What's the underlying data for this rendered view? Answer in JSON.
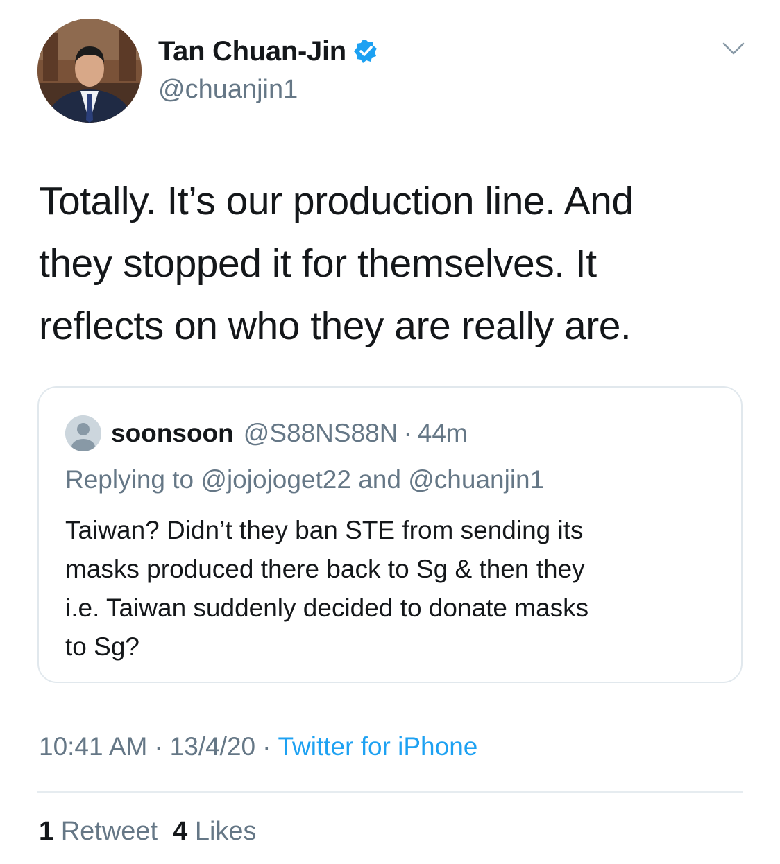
{
  "author": {
    "display_name": "Tan Chuan-Jin",
    "handle": "@chuanjin1",
    "verified": true
  },
  "icons": {
    "verified": "verified-badge-icon",
    "menu": "chevron-down-icon",
    "quoted_avatar": "default-profile-icon"
  },
  "tweet": {
    "text_lines": [
      "Totally. It’s our production line. And",
      "they stopped it for themselves. It",
      "reflects on who they are really are."
    ]
  },
  "quoted_tweet": {
    "display_name": "soonsoon",
    "handle": "@S88NS88N",
    "separator": "·",
    "time": "44m",
    "replying_to": "Replying to @jojojoget22 and @chuanjin1",
    "text_lines": [
      "Taiwan? Didn’t they ban STE from sending its",
      "masks produced there back to Sg & then they",
      "i.e. Taiwan suddenly decided to donate masks",
      "to Sg?"
    ]
  },
  "meta": {
    "time": "10:41 AM",
    "separator": "·",
    "date": "13/4/20",
    "source": "Twitter for iPhone"
  },
  "stats": {
    "retweets_count": "1",
    "retweets_label": "Retweet",
    "likes_count": "4",
    "likes_label": "Likes"
  },
  "colors": {
    "text": "#14171a",
    "secondary": "#657786",
    "link": "#1da1f2",
    "verified": "#1da1f2",
    "border": "#e1e8ed"
  }
}
